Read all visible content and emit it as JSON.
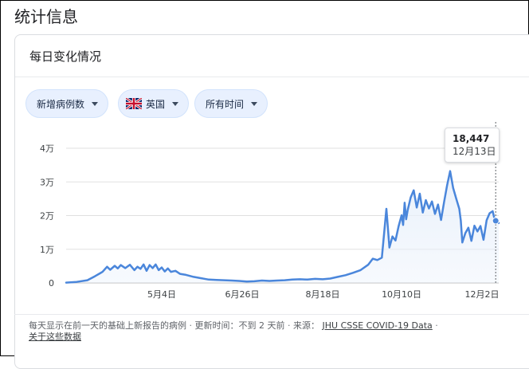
{
  "page_title": "统计信息",
  "card_title": "每日变化情况",
  "filters": [
    {
      "label": "新增病例数"
    },
    {
      "label": "英国",
      "flag": "uk-flag"
    },
    {
      "label": "所有时间"
    }
  ],
  "tooltip": {
    "value": "18,447",
    "date": "12月13日"
  },
  "footer": {
    "description": "每天显示在前一天的基础上新报告的病例",
    "updated": "更新时间：不到 2 天前",
    "source_label": "来源：",
    "source_link": "JHU CSSE COVID-19 Data",
    "about_link": "关于这些数据"
  },
  "colors": {
    "line": "#4a86db",
    "area": "#e8f0fb",
    "chip": "#e8f0fe",
    "grid": "#e0e0e0"
  },
  "chart_data": {
    "type": "area",
    "title": "",
    "xlabel": "",
    "ylabel": "",
    "x_tick_labels": [
      "5月4日",
      "6月26日",
      "8月18日",
      "10月10日",
      "12月2日"
    ],
    "x_tick_days": [
      64,
      117,
      170,
      222,
      275
    ],
    "y_tick_labels": [
      "0",
      "1万",
      "2万",
      "3万",
      "4万"
    ],
    "y_tick_values": [
      0,
      10000,
      20000,
      30000,
      40000
    ],
    "xlim": [
      1,
      286
    ],
    "ylim": [
      0,
      40000
    ],
    "x_axis_note": "x = day of year 2020",
    "grid": true,
    "series": [
      {
        "x": [
          1,
          8,
          15,
          20,
          25,
          28,
          30,
          33,
          35,
          37,
          40,
          43,
          46,
          48,
          50,
          52,
          54,
          56,
          58,
          60,
          62,
          64,
          66,
          68,
          70,
          73,
          76,
          80,
          85,
          90,
          95,
          100,
          105,
          110,
          115,
          120,
          125,
          130,
          135,
          140,
          145,
          150,
          155,
          160,
          165,
          170,
          175,
          180,
          185,
          190,
          195,
          200,
          203,
          206,
          209,
          212,
          214,
          216,
          218,
          220,
          222,
          223,
          224,
          225,
          226,
          228,
          230,
          232,
          234,
          236,
          238,
          240,
          242,
          244,
          246,
          248,
          250,
          252,
          254,
          256,
          258,
          260,
          261,
          262,
          264,
          266,
          268,
          270,
          272,
          274,
          276,
          278,
          280,
          282,
          283,
          284,
          286
        ],
        "values": [
          100,
          300,
          800,
          2000,
          3300,
          4800,
          3900,
          5100,
          4300,
          5300,
          4400,
          5400,
          3800,
          4800,
          4200,
          5500,
          3600,
          5300,
          4400,
          5500,
          3800,
          4600,
          3400,
          4300,
          3300,
          3600,
          2700,
          2400,
          1800,
          1400,
          1000,
          900,
          800,
          700,
          600,
          400,
          500,
          700,
          600,
          700,
          800,
          1000,
          1100,
          1000,
          1200,
          1100,
          1300,
          1800,
          2300,
          3000,
          3800,
          5400,
          7200,
          6800,
          7500,
          22000,
          10500,
          13800,
          12600,
          16800,
          20100,
          17200,
          23800,
          18900,
          21600,
          25400,
          27500,
          22400,
          26500,
          20900,
          24600,
          22100,
          24200,
          20500,
          23300,
          18700,
          24000,
          29000,
          33200,
          28200,
          25000,
          22000,
          18500,
          12000,
          14800,
          16400,
          12500,
          17000,
          15300,
          16900,
          12800,
          18600,
          20700,
          21300,
          19400,
          18447,
          17800
        ]
      }
    ]
  }
}
